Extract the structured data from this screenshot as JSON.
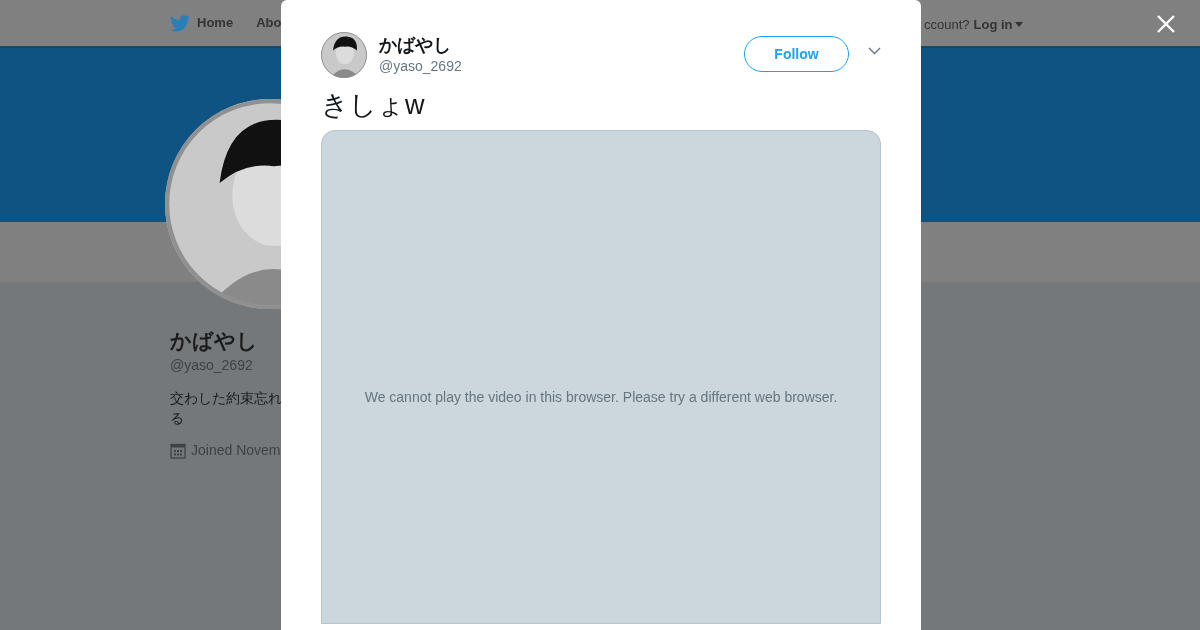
{
  "nav": {
    "items": [
      {
        "label": "Home"
      },
      {
        "label": "Abo"
      }
    ],
    "account_prompt": "ccount?",
    "login": "Log in"
  },
  "profile": {
    "name": "かばやし",
    "handle": "@yaso_2692",
    "bio_lines": [
      "交わした約束忘れ",
      "る"
    ],
    "joined": "Joined Novem"
  },
  "tweet_modal": {
    "author_name": "かばやし",
    "author_handle": "@yaso_2692",
    "follow_label": "Follow",
    "text": "きしょw",
    "video_message": "We cannot play the video in this browser. Please try a different web browser."
  }
}
